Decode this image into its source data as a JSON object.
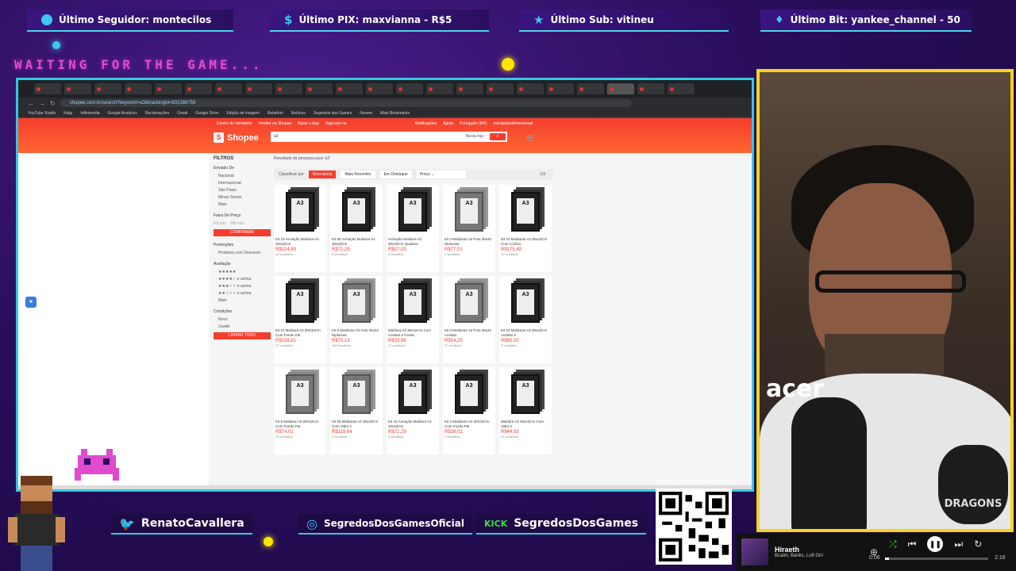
{
  "alerts": [
    {
      "icon": "follower-icon",
      "text": "Último Seguidor: montecilos"
    },
    {
      "icon": "dollar-icon",
      "text": "Último PIX: maxvianna - R$5"
    },
    {
      "icon": "star-icon",
      "text": "Último Sub: vitineu"
    },
    {
      "icon": "gem-icon",
      "text": "Último Bit: yankee_channel - 50"
    }
  ],
  "waiting_text": "WAITING FOR THE GAME...",
  "browser": {
    "url": "shopee.com.br/search?keyword=a3&trackingId=831388759",
    "bookmarks": [
      "YouTube Studio",
      "Kaiju",
      "Infinimedia",
      "Google Analytics",
      "Reclamações",
      "Gmail",
      "Google Drive",
      "Edição de imagem",
      "Relatório",
      "Notícias",
      "Segredos dos Games",
      "Nuvem",
      "Mais Bookmarks"
    ],
    "shopee": {
      "top_links": [
        "Centro do Vendedor",
        "Vender na Shopee",
        "Baixe o App",
        "Siga-nos no"
      ],
      "top_right": [
        "Notificações",
        "Ajuda",
        "Português (BR)",
        "mirrapiaksdimensional"
      ],
      "logo": "Shopee",
      "search_value": "a3",
      "search_scope": "Nesta loja",
      "results_for": "Resultado da pesquisa para 'a3'",
      "filters": {
        "title": "FILTROS",
        "location_title": "Enviado De",
        "locations": [
          "Nacional",
          "Internacional",
          "São Paulo",
          "Minas Gerais",
          "Mais"
        ],
        "price_title": "Faixa De Preço",
        "price_min": "R$ min",
        "price_max": "R$ máx",
        "apply": "CONFIRMAR",
        "promo_title": "Promoções",
        "promo_opt": "Produtos com Desconto",
        "rating_title": "Avaliação",
        "rating_opts": [
          "★★★★★",
          "★★★★☆ e acima",
          "★★★☆☆ e acima",
          "★★☆☆☆ e acima",
          "Mais"
        ],
        "condition_title": "Condições",
        "conditions": [
          "Novo",
          "Usado"
        ],
        "clear": "LIMPAR TUDO"
      },
      "sort": {
        "label": "Classificar por",
        "options": [
          "Relevância",
          "Mais Recentes",
          "Em Destaque"
        ],
        "price": "Preço",
        "page": "1/3"
      },
      "products": [
        {
          "name": "Kit 10 Armação Moldura A3 30x42Cm",
          "price": "R$124,93",
          "sold": "10 vendidos",
          "art": "stack"
        },
        {
          "name": "Kit 05 Armação Moldura A3 30x42Cm",
          "price": "R$72,29",
          "sold": "3 vendidos",
          "art": "stack"
        },
        {
          "name": "Armação Moldura A3 30x42Cm Quadros",
          "price": "R$27,03",
          "sold": "8 vendidos",
          "art": "single"
        },
        {
          "name": "Kit 3 Molduras A3 Foto 30x42 Diplomas",
          "price": "R$77,01",
          "sold": "4 vendidos",
          "art": "grey"
        },
        {
          "name": "Kit 10 Molduras A3 30x42Cm Com Acrílico",
          "price": "R$175,49",
          "sold": "12 vendidos",
          "art": "stack"
        },
        {
          "name": "Kit 10 Moldura A3 30X42Cm Com Fundo Pai",
          "price": "R$158,81",
          "sold": "27 vendidos",
          "art": "stack"
        },
        {
          "name": "Kit 5 Molduras A3 Foto 30x42 Diplomas",
          "price": "R$70,13",
          "sold": "100 vendidos",
          "art": "grey"
        },
        {
          "name": "Moldura A3 30x42Cm Com Acetato e Fundo",
          "price": "R$33,96",
          "sold": "17 vendidos",
          "art": "single"
        },
        {
          "name": "Kit 3 Molduras A3 Foto 30x42 Acetato",
          "price": "R$54,25",
          "sold": "37 vendidos",
          "art": "grey"
        },
        {
          "name": "Kit 10 Molduras A3 30x42Cm Acetato e",
          "price": "R$95,00",
          "sold": "3 vendidos",
          "art": "stack"
        },
        {
          "name": "Kit 5 Moldura A3 30X42Cm Com Fundo Pai",
          "price": "R$74,01",
          "sold": "10 vendidos",
          "art": "grey"
        },
        {
          "name": "Kit 05 Molduras A3 30x42Cm Com Vidro e",
          "price": "R$119,64",
          "sold": "3 vendidos",
          "art": "grey"
        },
        {
          "name": "Kit 10 Armação Moldura A3 30x42Cm",
          "price": "R$72,29",
          "sold": "3 vendidos",
          "art": "stack"
        },
        {
          "name": "Kit 2 Molduras A3 30X42Cm Com Fundo Pai",
          "price": "R$38,02",
          "sold": "4 vendidos",
          "art": "single"
        },
        {
          "name": "Moldura A3 30x42Cm Com Vidro e",
          "price": "R$44,93",
          "sold": "22 vendidos",
          "art": "single"
        }
      ]
    }
  },
  "socials": [
    {
      "icon": "twitter-icon",
      "handle": "RenatoCavallera"
    },
    {
      "icon": "instagram-icon",
      "handle": "SegredosDosGamesOficial"
    },
    {
      "icon": "kick-icon",
      "badge": "KICK",
      "handle": "SegredosDosGames"
    }
  ],
  "livepix": "livepix.gg/segredosdosgames",
  "player": {
    "title": "Hiraeth",
    "artist": "Bcalm, Banks, Lofi Girl",
    "current": "0:06",
    "total": "2:16",
    "progress": 0.04
  },
  "webcam": {
    "shirt_text": "acer",
    "logo_text": "DRAGONS"
  }
}
